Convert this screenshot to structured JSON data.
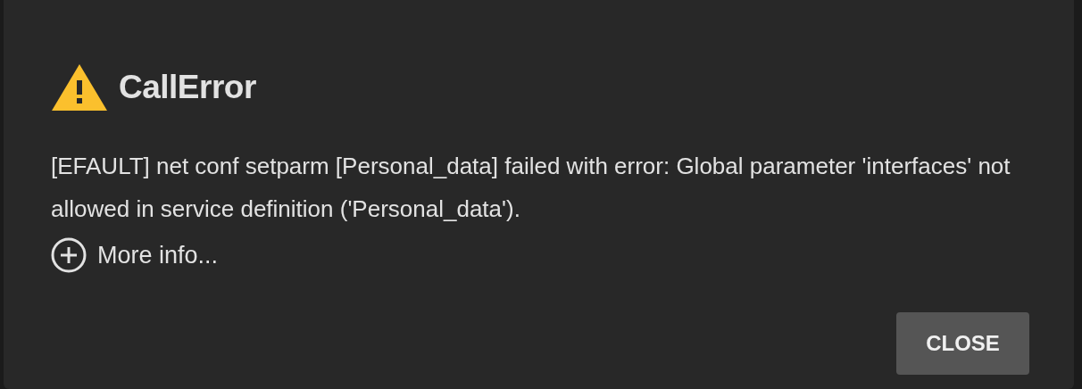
{
  "dialog": {
    "title": "CallError",
    "message": "[EFAULT] net conf setparm [Personal_data] failed with error: Global parameter 'interfaces' not allowed in service definition ('Personal_data').",
    "more_info": {
      "label": "More info...",
      "expanded": false
    },
    "buttons": [
      "CLOSE"
    ]
  }
}
